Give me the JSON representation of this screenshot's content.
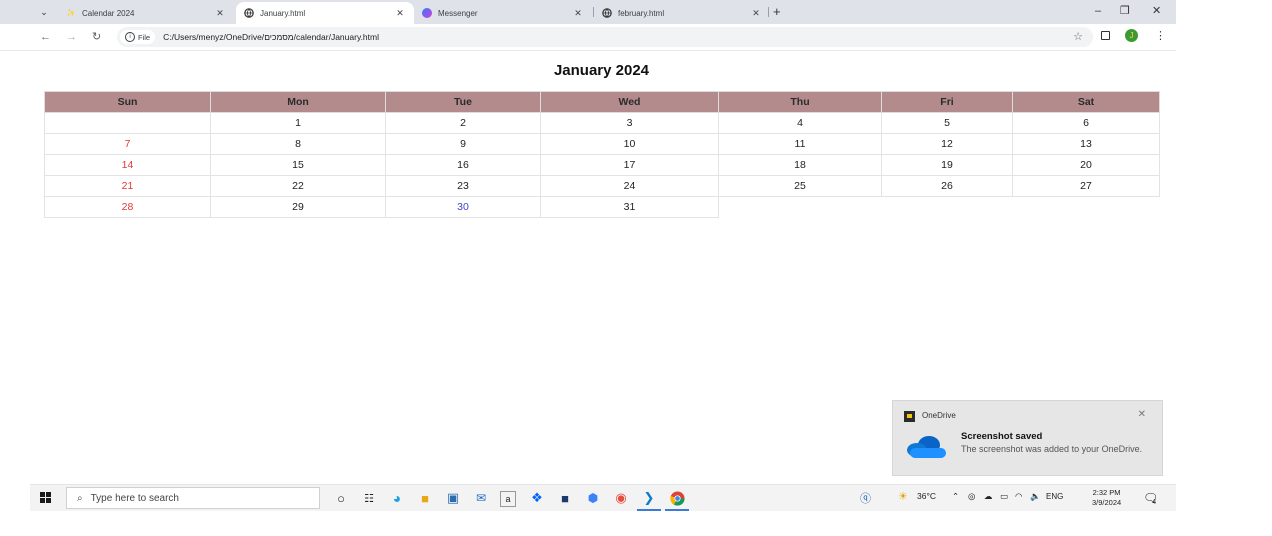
{
  "browser": {
    "tabs": [
      {
        "title": "Calendar 2024",
        "active": false,
        "icon": "calendar-favicon"
      },
      {
        "title": "January.html",
        "active": true,
        "icon": "globe-favicon"
      },
      {
        "title": "Messenger",
        "active": false,
        "icon": "messenger-favicon"
      },
      {
        "title": "february.html",
        "active": false,
        "icon": "globe-favicon"
      }
    ],
    "new_tab_label": "+",
    "file_chip_label": "File",
    "url": "C:/Users/menyz/OneDrive/מסמכים/calendar/January.html",
    "profile_initial": "J"
  },
  "calendar": {
    "title": "January 2024",
    "days": [
      "Sun",
      "Mon",
      "Tue",
      "Wed",
      "Thu",
      "Fri",
      "Sat"
    ],
    "weeks": [
      [
        "",
        "1",
        "2",
        "3",
        "4",
        "5",
        "6"
      ],
      [
        "7",
        "8",
        "9",
        "10",
        "11",
        "12",
        "13"
      ],
      [
        "14",
        "15",
        "16",
        "17",
        "18",
        "19",
        "20"
      ],
      [
        "21",
        "22",
        "23",
        "24",
        "25",
        "26",
        "27"
      ],
      [
        "28",
        "29",
        "30",
        "31",
        "",
        "",
        ""
      ]
    ],
    "highlighted_day": "30",
    "colors": {
      "header_bg": "#b38b8d",
      "sunday": "#e53935",
      "highlight": "#3b46c8"
    }
  },
  "toast": {
    "app_name": "OneDrive",
    "title": "Screenshot saved",
    "body": "The screenshot was added to your OneDrive."
  },
  "taskbar": {
    "search_placeholder": "Type here to search",
    "weather": "36°C",
    "language": "ENG",
    "time": "2:32 PM",
    "date": "3/9/2024",
    "notification_count": "4"
  }
}
